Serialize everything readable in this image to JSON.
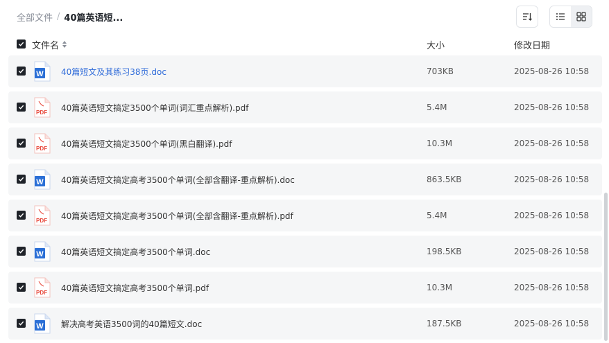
{
  "breadcrumb": {
    "root": "全部文件",
    "separator": "/",
    "current": "40篇英语短..."
  },
  "header": {
    "name": "文件名",
    "size": "大小",
    "date": "修改日期"
  },
  "files": [
    {
      "name": "40篇短文及其练习38页.doc",
      "type": "doc",
      "size": "703KB",
      "date": "2025-08-26 10:58"
    },
    {
      "name": "40篇英语短文搞定3500个单词(词汇重点解析).pdf",
      "type": "pdf",
      "size": "5.4M",
      "date": "2025-08-26 10:58"
    },
    {
      "name": "40篇英语短文搞定3500个单词(黑白翻译).pdf",
      "type": "pdf",
      "size": "10.3M",
      "date": "2025-08-26 10:58"
    },
    {
      "name": "40篇英语短文搞定高考3500个单词(全部含翻译-重点解析).doc",
      "type": "doc",
      "size": "863.5KB",
      "date": "2025-08-26 10:58"
    },
    {
      "name": "40篇英语短文搞定高考3500个单词(全部含翻译-重点解析).pdf",
      "type": "pdf",
      "size": "5.4M",
      "date": "2025-08-26 10:58"
    },
    {
      "name": "40篇英语短文搞定高考3500个单词.doc",
      "type": "doc",
      "size": "198.5KB",
      "date": "2025-08-26 10:58"
    },
    {
      "name": "40篇英语短文搞定高考3500个单词.pdf",
      "type": "pdf",
      "size": "10.3M",
      "date": "2025-08-26 10:58"
    },
    {
      "name": "解决高考英语3500词的40篇短文.doc",
      "type": "doc",
      "size": "187.5KB",
      "date": "2025-08-26 10:58"
    }
  ],
  "icons": {
    "sort": "sort-icon",
    "list_view": "list-view-icon",
    "grid_view": "grid-view-icon",
    "doc": "word-doc-icon",
    "pdf": "pdf-icon"
  },
  "colors": {
    "doc_blue": "#2b6fd6",
    "pdf_red": "#e8483b",
    "link_blue": "#2f6bd9"
  }
}
